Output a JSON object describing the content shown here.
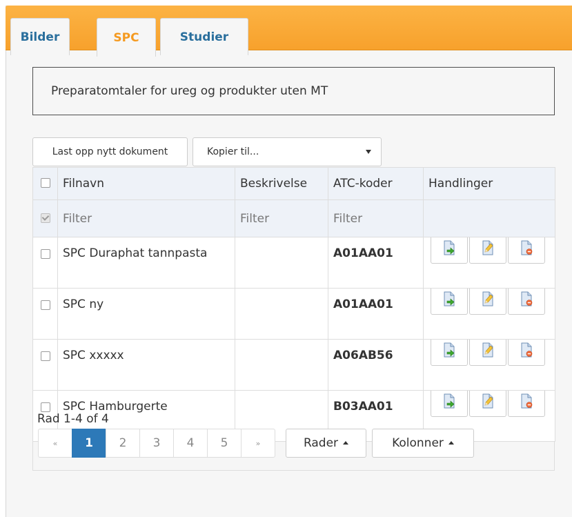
{
  "tabs": [
    {
      "label": "Bilder"
    },
    {
      "label": "SPC"
    },
    {
      "label": "Studier"
    }
  ],
  "info_text": "Preparatomtaler for ureg og produkter uten MT",
  "toolbar": {
    "upload_label": "Last opp nytt dokument",
    "copy_to_value": "Kopier til..."
  },
  "table": {
    "headers": {
      "filename": "Filnavn",
      "description": "Beskrivelse",
      "atc": "ATC-koder",
      "actions": "Handlinger"
    },
    "filter": {
      "filename": "Filter",
      "description": "Filter",
      "atc": "Filter"
    },
    "rows": [
      {
        "filename": "SPC Duraphat tannpasta",
        "description": "",
        "atc": "A01AA01"
      },
      {
        "filename": "SPC ny",
        "description": "",
        "atc": "A01AA01"
      },
      {
        "filename": "SPC xxxxx",
        "description": "",
        "atc": "A06AB56"
      },
      {
        "filename": "SPC Hamburgerte",
        "description": "",
        "atc": "B03AA01"
      }
    ]
  },
  "pagination": {
    "summary": "Rad 1-4 of 4",
    "first": "«",
    "pages": [
      "1",
      "2",
      "3",
      "4",
      "5"
    ],
    "active_page": "1",
    "last": "»"
  },
  "buttons": {
    "rows": "Rader",
    "columns": "Kolonner"
  },
  "colors": {
    "tab_bar": "#f7a12c",
    "tab_text": "#2a6f9d",
    "active_tab_text": "#f59a20",
    "active_page": "#2d79b8"
  },
  "icons": [
    "move-document-icon",
    "edit-document-icon",
    "delete-document-icon",
    "checkbox-icon",
    "caret-down-icon",
    "caret-up-icon"
  ]
}
